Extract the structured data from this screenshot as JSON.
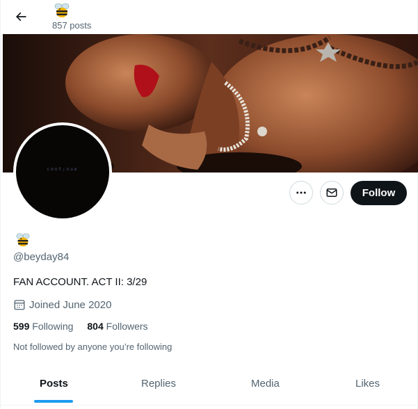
{
  "header": {
    "back_icon": "arrow-left-icon",
    "name_emoji": "🐝",
    "post_count": "857 posts"
  },
  "avatar": {
    "text": "cont;nue"
  },
  "actions": {
    "more_icon": "more-horizontal-icon",
    "mail_icon": "envelope-icon",
    "follow_label": "Follow"
  },
  "profile": {
    "name_emoji": "🐝",
    "handle": "@beyday84",
    "bio": "FAN ACCOUNT.  ACT II: 3/29",
    "joined": "Joined June 2020",
    "following_count": "599",
    "following_label": "Following",
    "followers_count": "804",
    "followers_label": "Followers",
    "not_followed": "Not followed by anyone you’re following"
  },
  "tabs": [
    {
      "label": "Posts",
      "active": true
    },
    {
      "label": "Replies",
      "active": false
    },
    {
      "label": "Media",
      "active": false
    },
    {
      "label": "Likes",
      "active": false
    }
  ],
  "colors": {
    "accent": "#1d9bf0",
    "text_primary": "#0f1419",
    "text_secondary": "#536471",
    "follow_bg": "#0f1419"
  }
}
